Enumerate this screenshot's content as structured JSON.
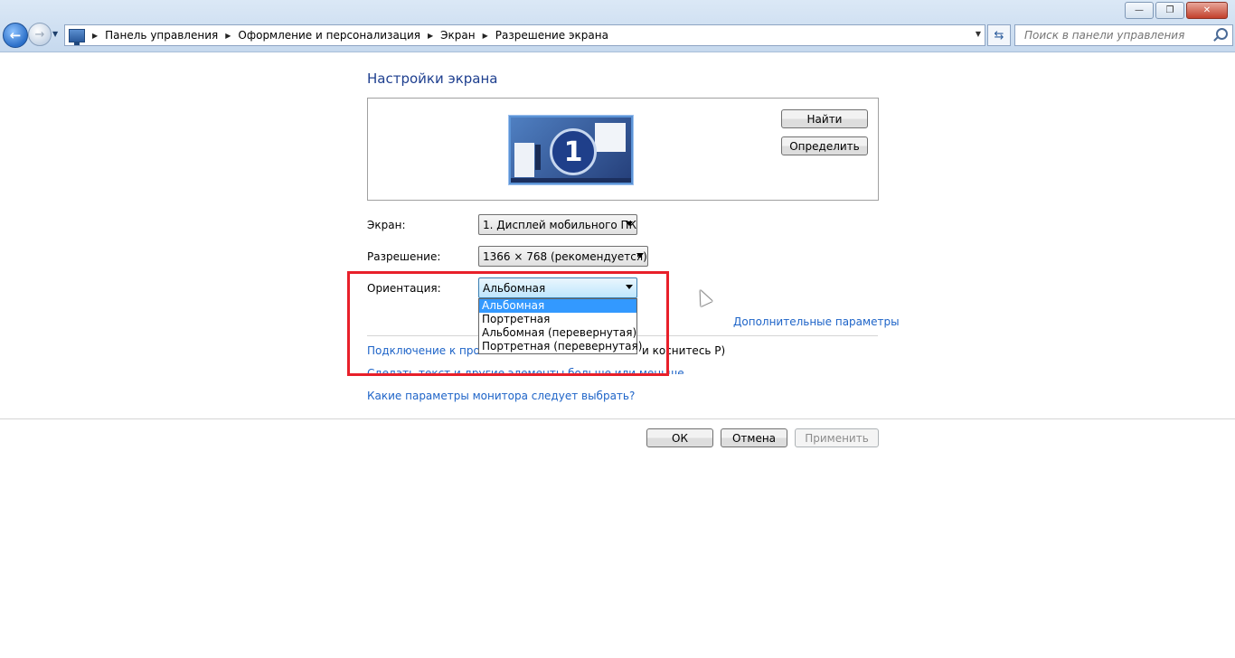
{
  "window": {
    "minimize_glyph": "—",
    "maximize_glyph": "❐",
    "close_glyph": "✕"
  },
  "nav": {
    "back_glyph": "←",
    "forward_glyph": "→",
    "history_glyph": "▼"
  },
  "address_bar": {
    "separator_glyph": "▶",
    "breadcrumbs": [
      "Панель управления",
      "Оформление и персонализация",
      "Экран",
      "Разрешение экрана"
    ],
    "dropdown_glyph": "▼",
    "refresh_glyph": "⇆"
  },
  "search": {
    "placeholder": "Поиск в панели управления"
  },
  "page": {
    "title": "Настройки экрана"
  },
  "preview": {
    "monitor_number": "1",
    "find_button": "Найти",
    "identify_button": "Определить"
  },
  "settings": {
    "display_label": "Экран:",
    "display_value": "1. Дисплей мобильного ПК",
    "resolution_label": "Разрешение:",
    "resolution_value": "1366 × 768 (рекомендуется)",
    "orientation_label": "Ориентация:",
    "orientation_value": "Альбомная",
    "orientation_options": [
      "Альбомная",
      "Портретная",
      "Альбомная (перевернутая)",
      "Портретная (перевернутая)"
    ],
    "orientation_selected_index": 0
  },
  "links": {
    "advanced": "Дополнительные параметры",
    "projector_visible": "Подключение к проек",
    "projector_tail": "и коснитесь P)",
    "text_size": "Сделать текст и другие элементы больше или меньше",
    "which_settings": "Какие параметры монитора следует выбрать?"
  },
  "buttons": {
    "ok": "ОК",
    "cancel": "Отмена",
    "apply": "Применить"
  },
  "colors": {
    "highlight_box": "#e8202a",
    "link": "#1e64c8",
    "title": "#1e3f8f",
    "selected_option": "#3399ff"
  }
}
